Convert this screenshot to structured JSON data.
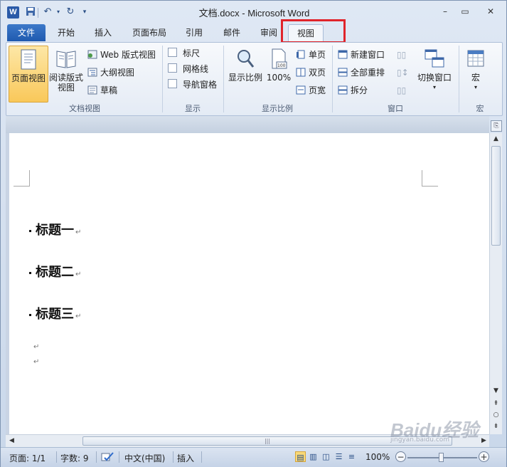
{
  "window": {
    "title": "文档.docx - Microsoft Word",
    "app_icon": "W",
    "controls": {
      "minimize": "–",
      "maximize": "▭",
      "close": "✕"
    }
  },
  "qat": {
    "save_icon": "save-icon",
    "undo_icon": "undo-icon",
    "redo_icon": "redo-icon",
    "customize_icon": "customize-icon"
  },
  "tabs": [
    {
      "label": "文件"
    },
    {
      "label": "开始"
    },
    {
      "label": "插入"
    },
    {
      "label": "页面布局"
    },
    {
      "label": "引用"
    },
    {
      "label": "邮件"
    },
    {
      "label": "审阅"
    },
    {
      "label": "视图"
    }
  ],
  "active_tab": "视图",
  "ribbon": {
    "doc_views": {
      "group_label": "文档视图",
      "print_layout": "页面视图",
      "full_reading_1": "阅读版式",
      "full_reading_2": "视图",
      "web_layout": "Web 版式视图",
      "outline": "大纲视图",
      "draft": "草稿"
    },
    "show": {
      "group_label": "显示",
      "ruler": "标尺",
      "gridlines": "网格线",
      "nav_pane": "导航窗格"
    },
    "zoom": {
      "group_label": "显示比例",
      "zoom": "显示比例",
      "zoom100": "100%",
      "one_page": "单页",
      "two_pages": "双页",
      "page_width": "页宽",
      "icon_digit": "100"
    },
    "window": {
      "group_label": "窗口",
      "new_window": "新建窗口",
      "arrange_all": "全部重排",
      "split": "拆分",
      "switch_windows": "切换窗口"
    },
    "macros": {
      "group_label": "宏",
      "macros": "宏"
    }
  },
  "document": {
    "headings": [
      "标题一",
      "标题二",
      "标题三"
    ],
    "para_mark": "↵"
  },
  "statusbar": {
    "page": "页面: 1/1",
    "words": "字数: 9",
    "language": "中文(中国)",
    "mode": "插入",
    "zoom": "100%",
    "zoom_minus": "−",
    "zoom_plus": "+"
  },
  "watermark": {
    "text": "Baidu经验",
    "sub": "jingyan.baidu.com"
  }
}
